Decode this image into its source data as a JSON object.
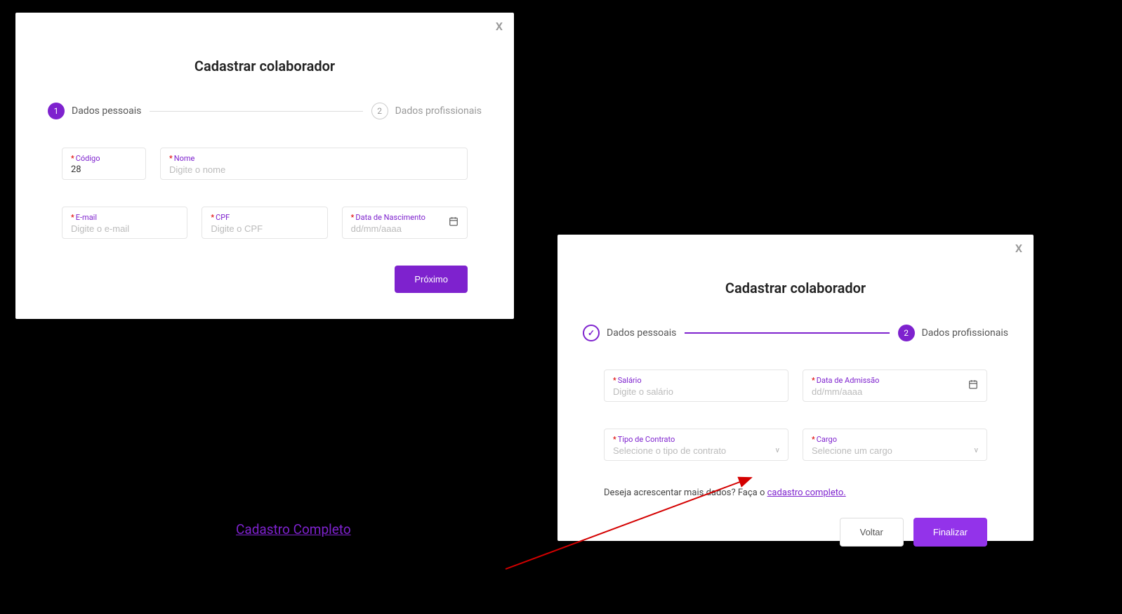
{
  "modal1": {
    "close": "X",
    "title": "Cadastrar colaborador",
    "step1_num": "1",
    "step1_label": "Dados pessoais",
    "step2_num": "2",
    "step2_label": "Dados profissionais",
    "codigo_label": "Código",
    "codigo_value": "28",
    "nome_label": "Nome",
    "nome_placeholder": "Digite o nome",
    "email_label": "E-mail",
    "email_placeholder": "Digite o e-mail",
    "cpf_label": "CPF",
    "cpf_placeholder": "Digite o CPF",
    "dob_label": "Data de Nascimento",
    "dob_placeholder": "dd/mm/aaaa",
    "next_button": "Próximo",
    "asterisk": "*"
  },
  "modal2": {
    "close": "X",
    "title": "Cadastrar colaborador",
    "step1_check": "✓",
    "step1_label": "Dados pessoais",
    "step2_num": "2",
    "step2_label": "Dados profissionais",
    "salario_label": "Salário",
    "salario_placeholder": "Digite o salário",
    "admissao_label": "Data de Admissão",
    "admissao_placeholder": "dd/mm/aaaa",
    "contrato_label": "Tipo de Contrato",
    "contrato_placeholder": "Selecione o tipo de contrato",
    "cargo_label": "Cargo",
    "cargo_placeholder": "Selecione um cargo",
    "extra_text": "Deseja acrescentar mais dados? Faça o ",
    "extra_link": "cadastro completo.",
    "back_button": "Voltar",
    "finish_button": "Finalizar",
    "asterisk": "*",
    "chevron": "v"
  },
  "annotation": {
    "cadastro_completo": "Cadastro Completo"
  }
}
